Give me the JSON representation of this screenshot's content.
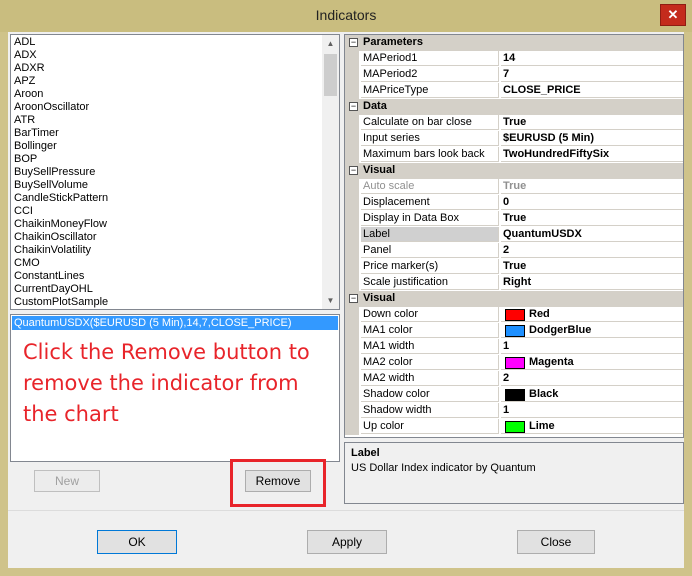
{
  "window": {
    "title": "Indicators",
    "close_glyph": "✕"
  },
  "indicator_list": {
    "items": [
      "ADL",
      "ADX",
      "ADXR",
      "APZ",
      "Aroon",
      "AroonOscillator",
      "ATR",
      "BarTimer",
      "Bollinger",
      "BOP",
      "BuySellPressure",
      "BuySellVolume",
      "CandleStickPattern",
      "CCI",
      "ChaikinMoneyFlow",
      "ChaikinOscillator",
      "ChaikinVolatility",
      "CMO",
      "ConstantLines",
      "CurrentDayOHL",
      "CustomPlotSample"
    ]
  },
  "applied": {
    "selected_item": "QuantumUSDX($EURUSD (5 Min),14,7,CLOSE_PRICE)",
    "annotation": "Click the Remove button to remove the indicator from the chart"
  },
  "buttons": {
    "new": "New",
    "remove": "Remove",
    "ok": "OK",
    "apply": "Apply",
    "close": "Close"
  },
  "properties": {
    "parameters": {
      "label": "Parameters",
      "rows": [
        {
          "name": "MAPeriod1",
          "value": "14"
        },
        {
          "name": "MAPeriod2",
          "value": "7"
        },
        {
          "name": "MAPriceType",
          "value": "CLOSE_PRICE"
        }
      ]
    },
    "data": {
      "label": "Data",
      "rows": [
        {
          "name": "Calculate on bar close",
          "value": "True"
        },
        {
          "name": "Input series",
          "value": "$EURUSD (5 Min)"
        },
        {
          "name": "Maximum bars look back",
          "value": "TwoHundredFiftySix"
        }
      ]
    },
    "visual": {
      "label": "Visual",
      "rows": [
        {
          "name": "Auto scale",
          "value": "True"
        },
        {
          "name": "Displacement",
          "value": "0"
        },
        {
          "name": "Display in Data Box",
          "value": "True"
        },
        {
          "name": "Label",
          "value": "QuantumUSDX"
        },
        {
          "name": "Panel",
          "value": "2"
        },
        {
          "name": "Price marker(s)",
          "value": "True"
        },
        {
          "name": "Scale justification",
          "value": "Right"
        }
      ]
    },
    "visual2": {
      "label": "Visual",
      "rows": [
        {
          "name": "Down color",
          "value": "Red",
          "color": "#ff0000"
        },
        {
          "name": "MA1 color",
          "value": "DodgerBlue",
          "color": "#1e90ff"
        },
        {
          "name": "MA1 width",
          "value": "1"
        },
        {
          "name": "MA2 color",
          "value": "Magenta",
          "color": "#ff00ff"
        },
        {
          "name": "MA2 width",
          "value": "2"
        },
        {
          "name": "Shadow color",
          "value": "Black",
          "color": "#000000"
        },
        {
          "name": "Shadow width",
          "value": "1"
        },
        {
          "name": "Up color",
          "value": "Lime",
          "color": "#00ff00"
        }
      ]
    }
  },
  "description": {
    "title": "Label",
    "text": "US Dollar Index indicator by Quantum"
  },
  "colors": {
    "annotation": "#e8242a",
    "selection": "#3399ff"
  }
}
